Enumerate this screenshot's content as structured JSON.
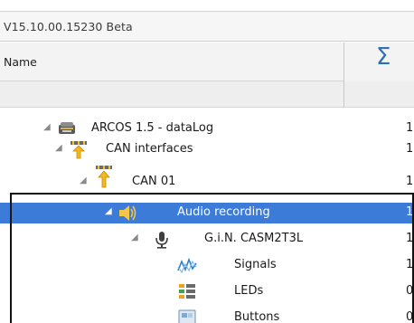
{
  "app": {
    "version": "V15.10.00.15230 Beta"
  },
  "columns": {
    "name_header": "Name",
    "sum_header_icon": "sigma-icon",
    "sum_header_glyph": "Σ"
  },
  "tree": {
    "rows": [
      {
        "label": "ARCOS 1.5 - dataLog",
        "count": "1",
        "icon": "device-icon",
        "expanded": true
      },
      {
        "label": "CAN interfaces",
        "count": "1",
        "icon": "can-interface-icon",
        "expanded": true
      },
      {
        "label": "CAN 01",
        "count": "1",
        "icon": "can-channel-icon",
        "expanded": true
      },
      {
        "label": "Audio recording",
        "count": "1",
        "icon": "speaker-icon",
        "expanded": true,
        "selected": true
      },
      {
        "label": "G.i.N. CASM2T3L",
        "count": "1",
        "icon": "microphone-icon",
        "expanded": true
      },
      {
        "label": "Signals",
        "count": "1",
        "icon": "signal-wave-icon"
      },
      {
        "label": "LEDs",
        "count": "0",
        "icon": "led-list-icon"
      },
      {
        "label": "Buttons",
        "count": "0",
        "icon": "buttons-icon"
      }
    ]
  },
  "colors": {
    "selection": "#3d7bd8",
    "sigma": "#2f6fb6"
  }
}
